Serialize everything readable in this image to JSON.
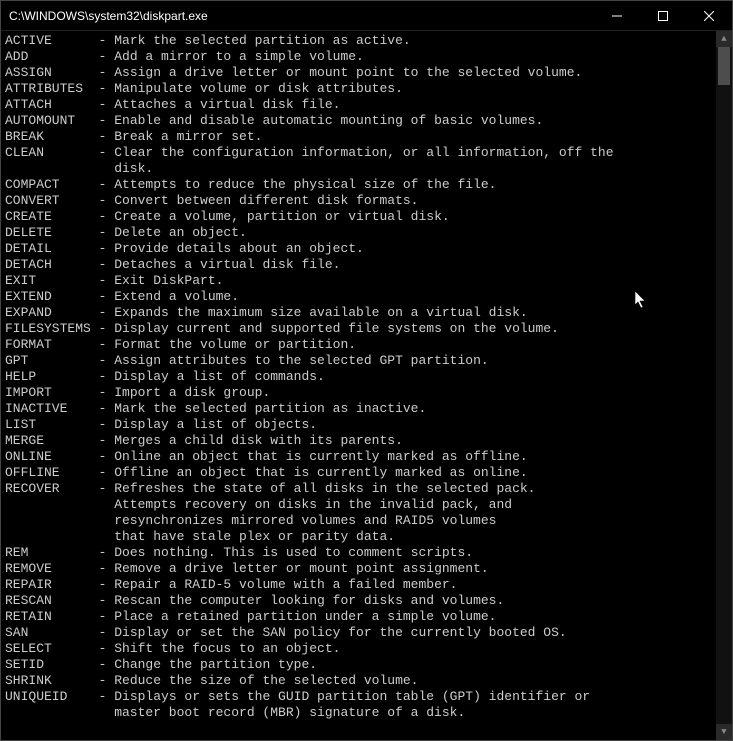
{
  "window": {
    "title": "C:\\WINDOWS\\system32\\diskpart.exe"
  },
  "commands": [
    {
      "cmd": "ACTIVE",
      "desc": [
        "Mark the selected partition as active."
      ]
    },
    {
      "cmd": "ADD",
      "desc": [
        "Add a mirror to a simple volume."
      ]
    },
    {
      "cmd": "ASSIGN",
      "desc": [
        "Assign a drive letter or mount point to the selected volume."
      ]
    },
    {
      "cmd": "ATTRIBUTES",
      "desc": [
        "Manipulate volume or disk attributes."
      ]
    },
    {
      "cmd": "ATTACH",
      "desc": [
        "Attaches a virtual disk file."
      ]
    },
    {
      "cmd": "AUTOMOUNT",
      "desc": [
        "Enable and disable automatic mounting of basic volumes."
      ]
    },
    {
      "cmd": "BREAK",
      "desc": [
        "Break a mirror set."
      ]
    },
    {
      "cmd": "CLEAN",
      "desc": [
        "Clear the configuration information, or all information, off the",
        "disk."
      ]
    },
    {
      "cmd": "COMPACT",
      "desc": [
        "Attempts to reduce the physical size of the file."
      ]
    },
    {
      "cmd": "CONVERT",
      "desc": [
        "Convert between different disk formats."
      ]
    },
    {
      "cmd": "CREATE",
      "desc": [
        "Create a volume, partition or virtual disk."
      ]
    },
    {
      "cmd": "DELETE",
      "desc": [
        "Delete an object."
      ]
    },
    {
      "cmd": "DETAIL",
      "desc": [
        "Provide details about an object."
      ]
    },
    {
      "cmd": "DETACH",
      "desc": [
        "Detaches a virtual disk file."
      ]
    },
    {
      "cmd": "EXIT",
      "desc": [
        "Exit DiskPart."
      ]
    },
    {
      "cmd": "EXTEND",
      "desc": [
        "Extend a volume."
      ]
    },
    {
      "cmd": "EXPAND",
      "desc": [
        "Expands the maximum size available on a virtual disk."
      ]
    },
    {
      "cmd": "FILESYSTEMS",
      "desc": [
        "Display current and supported file systems on the volume."
      ]
    },
    {
      "cmd": "FORMAT",
      "desc": [
        "Format the volume or partition."
      ]
    },
    {
      "cmd": "GPT",
      "desc": [
        "Assign attributes to the selected GPT partition."
      ]
    },
    {
      "cmd": "HELP",
      "desc": [
        "Display a list of commands."
      ]
    },
    {
      "cmd": "IMPORT",
      "desc": [
        "Import a disk group."
      ]
    },
    {
      "cmd": "INACTIVE",
      "desc": [
        "Mark the selected partition as inactive."
      ]
    },
    {
      "cmd": "LIST",
      "desc": [
        "Display a list of objects."
      ]
    },
    {
      "cmd": "MERGE",
      "desc": [
        "Merges a child disk with its parents."
      ]
    },
    {
      "cmd": "ONLINE",
      "desc": [
        "Online an object that is currently marked as offline."
      ]
    },
    {
      "cmd": "OFFLINE",
      "desc": [
        "Offline an object that is currently marked as online."
      ]
    },
    {
      "cmd": "RECOVER",
      "desc": [
        "Refreshes the state of all disks in the selected pack.",
        "Attempts recovery on disks in the invalid pack, and",
        "resynchronizes mirrored volumes and RAID5 volumes",
        "that have stale plex or parity data."
      ]
    },
    {
      "cmd": "REM",
      "desc": [
        "Does nothing. This is used to comment scripts."
      ]
    },
    {
      "cmd": "REMOVE",
      "desc": [
        "Remove a drive letter or mount point assignment."
      ]
    },
    {
      "cmd": "REPAIR",
      "desc": [
        "Repair a RAID-5 volume with a failed member."
      ]
    },
    {
      "cmd": "RESCAN",
      "desc": [
        "Rescan the computer looking for disks and volumes."
      ]
    },
    {
      "cmd": "RETAIN",
      "desc": [
        "Place a retained partition under a simple volume."
      ]
    },
    {
      "cmd": "SAN",
      "desc": [
        "Display or set the SAN policy for the currently booted OS."
      ]
    },
    {
      "cmd": "SELECT",
      "desc": [
        "Shift the focus to an object."
      ]
    },
    {
      "cmd": "SETID",
      "desc": [
        "Change the partition type."
      ]
    },
    {
      "cmd": "SHRINK",
      "desc": [
        "Reduce the size of the selected volume."
      ]
    },
    {
      "cmd": "UNIQUEID",
      "desc": [
        "Displays or sets the GUID partition table (GPT) identifier or",
        "master boot record (MBR) signature of a disk."
      ]
    }
  ]
}
